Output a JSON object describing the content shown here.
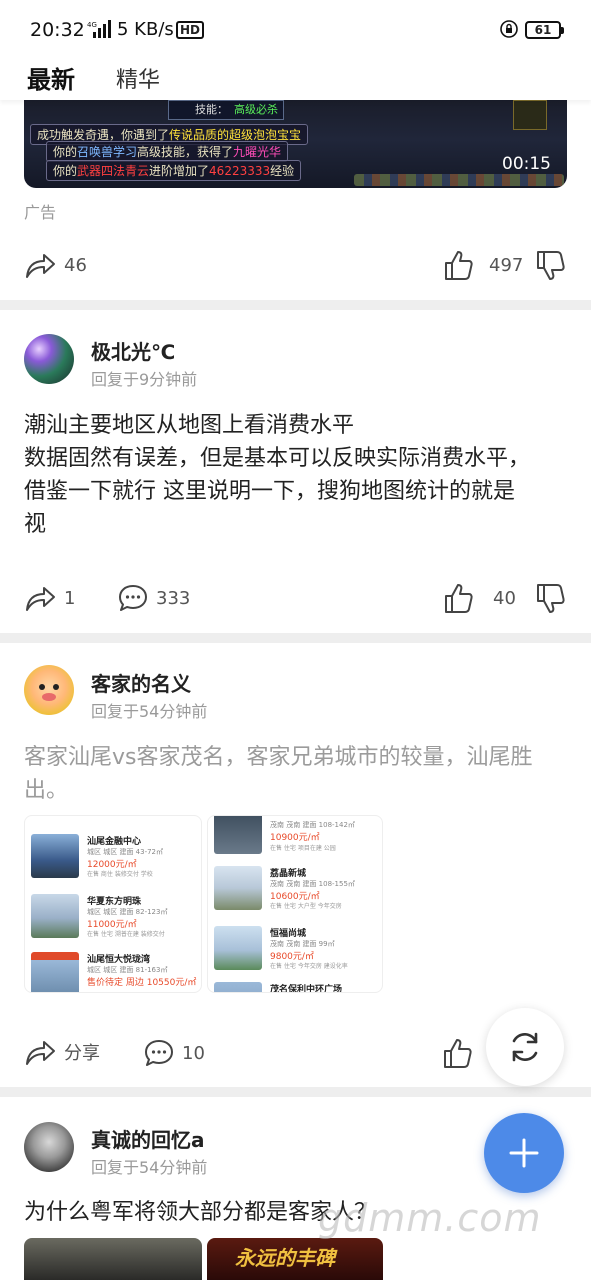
{
  "status_bar": {
    "time": "20:32",
    "network_speed": "5 KB/s",
    "hd_label": "HD",
    "battery": "61",
    "network_type": "4G"
  },
  "tabs": [
    {
      "label": "最新",
      "active": true
    },
    {
      "label": "精华",
      "active": false
    }
  ],
  "ad": {
    "skill_text": "技能：",
    "skill_value": "高级必杀",
    "line1": "成功触发奇遇，你遇到了",
    "line1_hl": "传说品质的超级泡泡宝宝",
    "line2": "你的",
    "line2_a": "召唤兽学习",
    "line2_b": "高级技能，获得了",
    "line2_c": "九曜光华",
    "line3": "你的",
    "line3_a": "武器四法青云",
    "line3_b": "进阶增加了",
    "line3_c": "46223333",
    "line3_d": "经验",
    "duration": "00:15",
    "label": "广告",
    "share_count": "46",
    "like_count": "497"
  },
  "posts": [
    {
      "username": "极北光℃",
      "meta": "回复于9分钟前",
      "text_lines": [
        "潮汕主要地区从地图上看消费水平",
        "数据固然有误差，但是基本可以反映实际消费水平，",
        "借鉴一下就行 这里说明一下，搜狗地图统计的就是",
        "视"
      ],
      "share_count": "1",
      "comment_count": "333",
      "like_count": "40"
    },
    {
      "username": "客家的名义",
      "meta": "回复于54分钟前",
      "text_lines": [
        "客家汕尾vs客家茂名，客家兄弟城市的较量，汕尾胜",
        "出。"
      ],
      "share_label": "分享",
      "comment_count": "10",
      "left_listings": [
        {
          "name": "汕尾金融中心",
          "sub": "城区  城区   建面 43-72㎡",
          "price": "12000元/㎡",
          "tags": "在售  商住   装修交付   学校"
        },
        {
          "name": "华夏东方明珠",
          "sub": "城区  城区   建面 82-123㎡",
          "price": "11000元/㎡",
          "tags": "在售  住宅   溯普在建   装修交付"
        },
        {
          "name": "汕尾恒大悦珑湾",
          "sub": "城区  城区   建面 81-163㎡",
          "price": "售价待定   周边 10550元/㎡",
          "tags": ""
        }
      ],
      "right_listings": [
        {
          "name": "",
          "sub": "茂南  茂南   建面 108-142㎡",
          "price": "10900元/㎡",
          "tags": "在售  住宅   项目在建   公园"
        },
        {
          "name": "荔晶新城",
          "sub": "茂南  茂南   建面 108-155㎡",
          "price": "10600元/㎡",
          "tags": "在售  住宅   大户型   今年交房"
        },
        {
          "name": "恒福尚城",
          "sub": "茂南  茂南   建面 99㎡",
          "price": "9800元/㎡",
          "tags": "在售  住宅   今年交房   建设化率"
        },
        {
          "name": "茂名保利中环广场",
          "sub": "",
          "price": "",
          "tags": ""
        }
      ]
    },
    {
      "username": "真诚的回忆a",
      "meta": "回复于54分钟前",
      "text_lines": [
        "为什么粤军将领大部分都是客家人？"
      ],
      "image_caption": "永远的丰碑"
    }
  ],
  "watermark": "gdmm.com",
  "colors": {
    "accent_blue": "#4d8ae8",
    "divider": "#eeeeee",
    "meta_grey": "#9a9a9a",
    "price_red": "#e84a2a"
  }
}
